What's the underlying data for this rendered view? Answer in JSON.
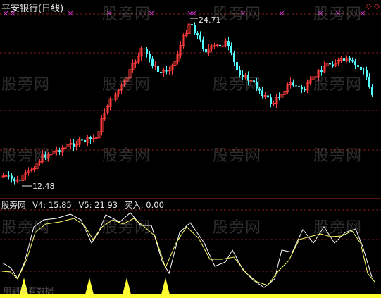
{
  "header": {
    "title": "平安银行(日线)"
  },
  "indicator": {
    "name": "股旁网",
    "v4": "V4: 15.85",
    "v5": "V5: 21.93",
    "buy": "买入: 0.00"
  },
  "labels": {
    "high": "24.71",
    "low": "12.48"
  },
  "watermark": {
    "text": "股旁网",
    "bottom_text": "用到专有数据"
  },
  "icons": {
    "top_right": [
      "diamond-icon",
      "diamond-icon"
    ],
    "markers": "x-marker-icon"
  },
  "colors": {
    "up": "#ff3b3b",
    "down": "#54ffff",
    "grid": "#7a1e1e",
    "line_white": "#ffffff",
    "line_yellow": "#ffff66",
    "marker": "#cc33cc"
  },
  "chart_data": [
    {
      "type": "candlestick",
      "title": "平安银行(日线)",
      "annotations": [
        "24.71",
        "12.48"
      ],
      "visible_high": 24.71,
      "visible_low": 12.48
    },
    {
      "type": "line",
      "series": [
        {
          "name": "V4",
          "last": 15.85
        },
        {
          "name": "V5",
          "last": 21.93
        },
        {
          "name": "买入",
          "last": 0.0
        }
      ]
    }
  ]
}
